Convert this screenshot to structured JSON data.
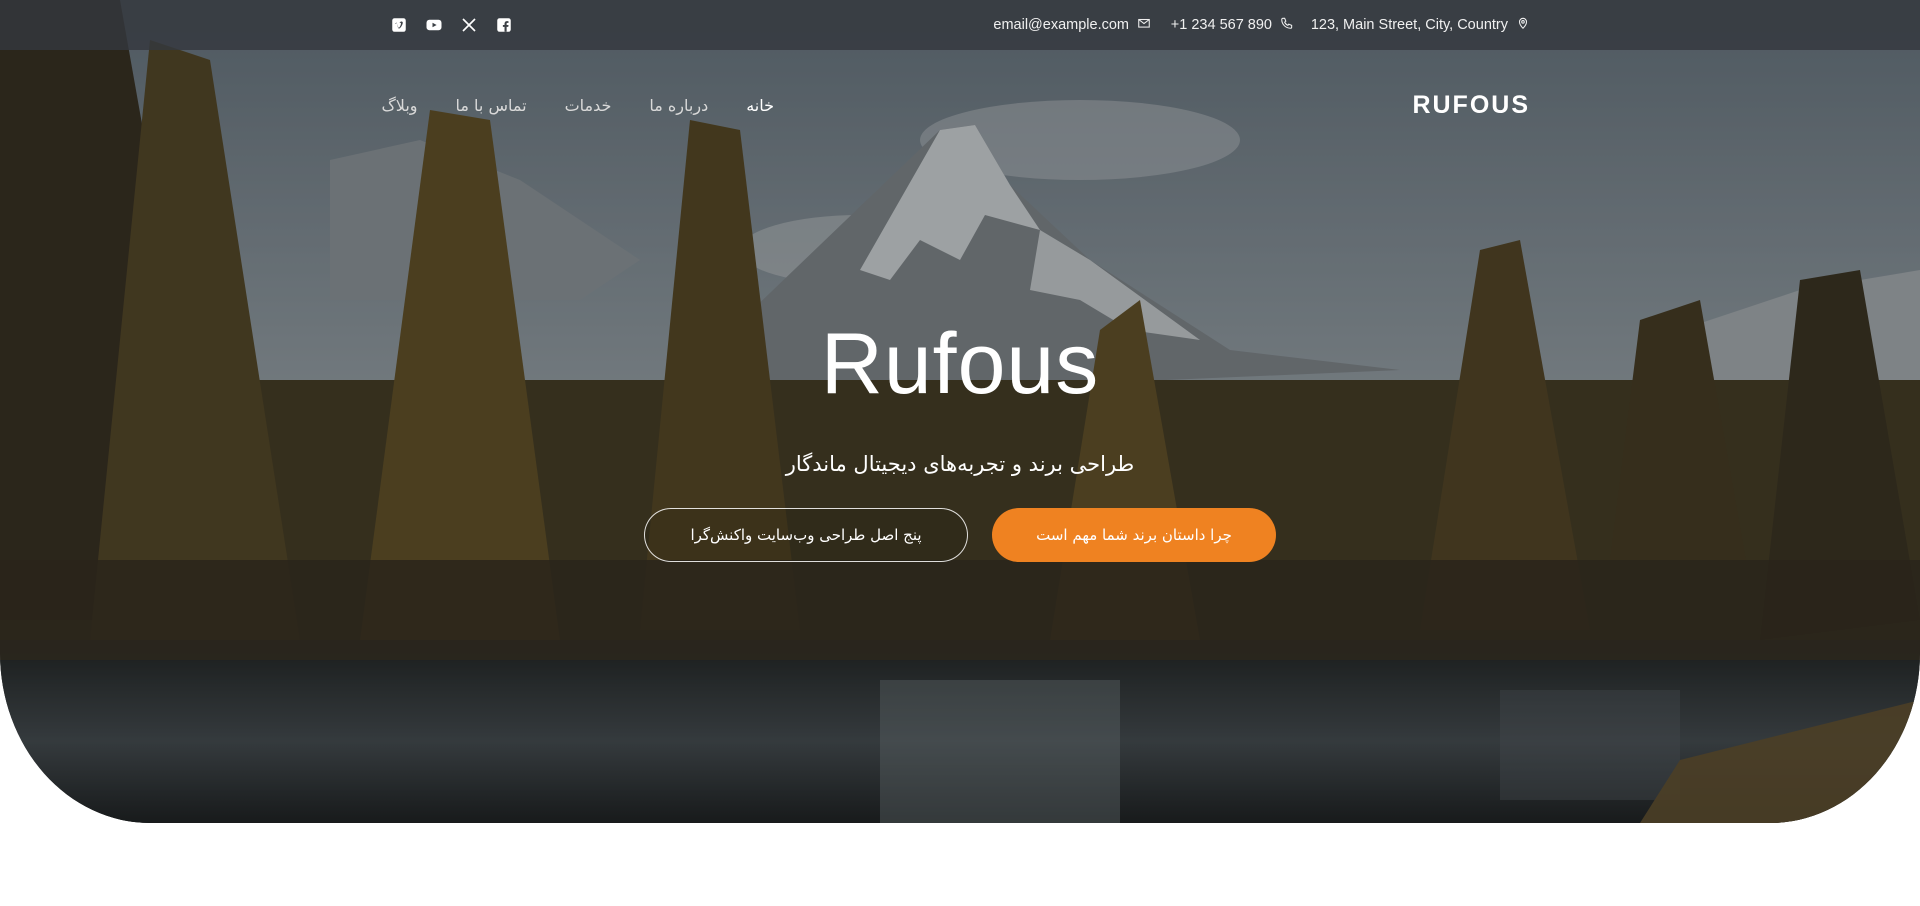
{
  "topbar": {
    "address": "123, Main Street, City, Country",
    "phone": "+1 234 567 890",
    "email": "email@example.com",
    "social": [
      "facebook-icon",
      "x-icon",
      "youtube-icon",
      "vimeo-icon"
    ]
  },
  "brand": "RUFOUS",
  "nav": {
    "items": [
      "خانه",
      "درباره ما",
      "خدمات",
      "تماس با ما",
      "وبلاگ"
    ],
    "active": "خانه"
  },
  "hero": {
    "title": "Rufous",
    "subtitle": "طراحی برند و تجربه‌های دیجیتال ماندگار",
    "primary_button": "چرا داستان برند شما مهم است",
    "secondary_button": "پنج اصل طراحی وب‌سایت واکنش‌گرا"
  },
  "colors": {
    "accent": "#ef8221",
    "topbar": "#34383e"
  }
}
